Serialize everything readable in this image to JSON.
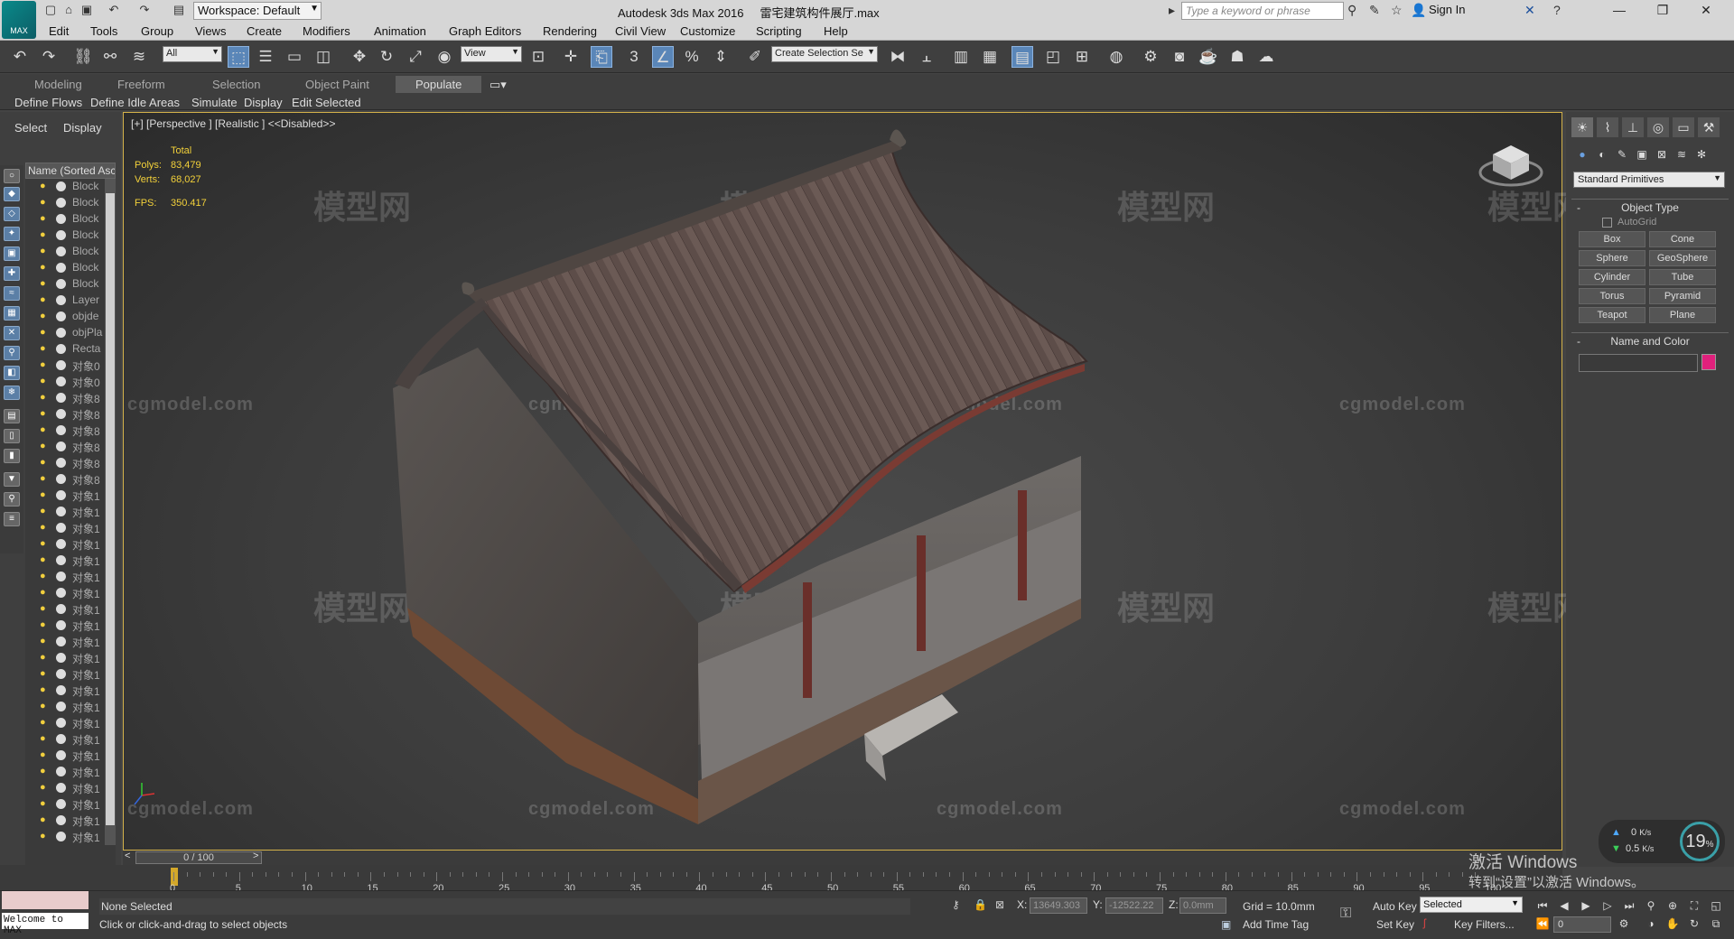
{
  "app": {
    "title": "Autodesk 3ds Max 2016",
    "file": "雷宅建筑构件展厅.max",
    "logo_text": "MAX",
    "workspace": "Workspace: Default",
    "search_placeholder": "Type a keyword or phrase",
    "sign_in": "Sign In"
  },
  "menu": [
    "Edit",
    "Tools",
    "Group",
    "Views",
    "Create",
    "Modifiers",
    "Animation",
    "Graph Editors",
    "Rendering",
    "Civil View",
    "Customize",
    "Scripting",
    "Help"
  ],
  "toolbar": {
    "filter": "All",
    "view": "View",
    "create_selection": "Create Selection Se",
    "snap_number": "3",
    "percent": "%"
  },
  "ribbon": {
    "tabs": [
      "Modeling",
      "Freeform",
      "Selection",
      "Object Paint",
      "Populate"
    ],
    "active_tab": "Populate",
    "subtabs": [
      "Define Flows",
      "Define Idle Areas",
      "Simulate",
      "Display",
      "Edit Selected"
    ]
  },
  "explorer": {
    "tabs": [
      "Select",
      "Display"
    ],
    "header": "Name (Sorted Asc",
    "rows": [
      "Block",
      "Block",
      "Block",
      "Block",
      "Block",
      "Block",
      "Block",
      "Layer",
      "objde",
      "objPla",
      "Recta",
      "对象0",
      "对象0",
      "对象8",
      "对象8",
      "对象8",
      "对象8",
      "对象8",
      "对象8",
      "对象1",
      "对象1",
      "对象1",
      "对象1",
      "对象1",
      "对象1",
      "对象1",
      "对象1",
      "对象1",
      "对象1",
      "对象1",
      "对象1",
      "对象1",
      "对象1",
      "对象1",
      "对象1",
      "对象1",
      "对象1",
      "对象1",
      "对象1",
      "对象1",
      "对象1"
    ]
  },
  "viewport": {
    "label": "[+] [Perspective ] [Realistic ]  <<Disabled>>",
    "stats_total": "Total",
    "polys_label": "Polys:",
    "polys": "83,479",
    "verts_label": "Verts:",
    "verts": "68,027",
    "fps_label": "FPS:",
    "fps": "350.417",
    "watermark_cn": "模型网",
    "watermark_url": "cgmodel.com"
  },
  "command_panel": {
    "dropdown": "Standard Primitives",
    "object_type": "Object Type",
    "autogrid": "AutoGrid",
    "buttons": [
      "Box",
      "Cone",
      "Sphere",
      "GeoSphere",
      "Cylinder",
      "Tube",
      "Torus",
      "Pyramid",
      "Teapot",
      "Plane"
    ],
    "name_color": "Name and Color",
    "swatch_color": "#e0207c"
  },
  "timeline": {
    "frame_display": "0 / 100",
    "ticks": [
      "0",
      "5",
      "10",
      "15",
      "20",
      "25",
      "30",
      "35",
      "40",
      "45",
      "50",
      "55",
      "60",
      "65",
      "70",
      "75",
      "80",
      "85",
      "90",
      "95",
      "100"
    ]
  },
  "status": {
    "welcome": "Welcome to MAX",
    "selection": "None Selected",
    "prompt": "Click or click-and-drag to select objects",
    "x_label": "X:",
    "x": "13649.303",
    "y_label": "Y:",
    "y": "-12522.22",
    "z_label": "Z:",
    "z": "0.0mm",
    "grid": "Grid = 10.0mm",
    "add_time_tag": "Add Time Tag",
    "auto_key": "Auto Key",
    "selected": "Selected",
    "set_key": "Set Key",
    "key_filters": "Key Filters...",
    "frame": "0"
  },
  "perf": {
    "up": "0",
    "up_unit": "K/s",
    "down": "0.5",
    "down_unit": "K/s",
    "percent": "19",
    "percent_sign": "%"
  },
  "activation": {
    "line1": "激活 Windows",
    "line2": "转到“设置”以激活 Windows。"
  }
}
